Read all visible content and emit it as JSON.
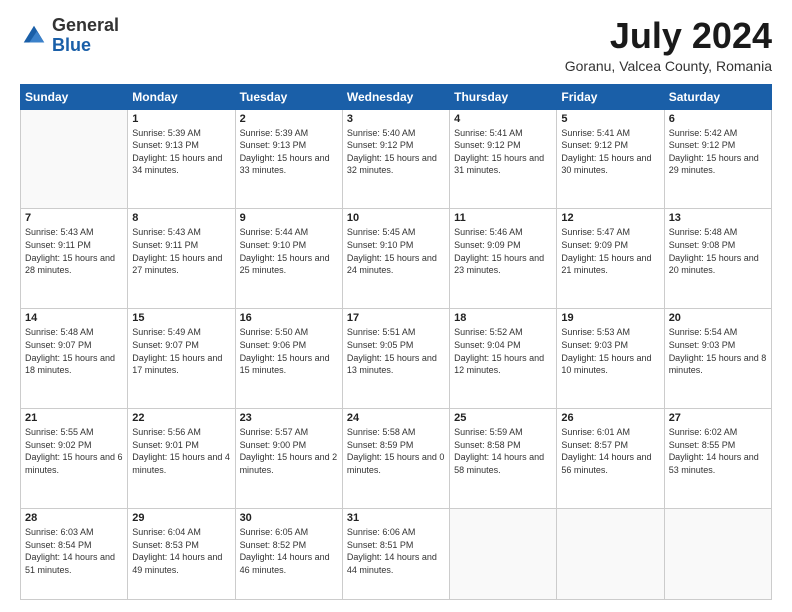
{
  "header": {
    "logo_general": "General",
    "logo_blue": "Blue",
    "month_title": "July 2024",
    "location": "Goranu, Valcea County, Romania"
  },
  "days": [
    "Sunday",
    "Monday",
    "Tuesday",
    "Wednesday",
    "Thursday",
    "Friday",
    "Saturday"
  ],
  "weeks": [
    [
      {
        "date": "",
        "sunrise": "",
        "sunset": "",
        "daylight": ""
      },
      {
        "date": "1",
        "sunrise": "Sunrise: 5:39 AM",
        "sunset": "Sunset: 9:13 PM",
        "daylight": "Daylight: 15 hours and 34 minutes."
      },
      {
        "date": "2",
        "sunrise": "Sunrise: 5:39 AM",
        "sunset": "Sunset: 9:13 PM",
        "daylight": "Daylight: 15 hours and 33 minutes."
      },
      {
        "date": "3",
        "sunrise": "Sunrise: 5:40 AM",
        "sunset": "Sunset: 9:12 PM",
        "daylight": "Daylight: 15 hours and 32 minutes."
      },
      {
        "date": "4",
        "sunrise": "Sunrise: 5:41 AM",
        "sunset": "Sunset: 9:12 PM",
        "daylight": "Daylight: 15 hours and 31 minutes."
      },
      {
        "date": "5",
        "sunrise": "Sunrise: 5:41 AM",
        "sunset": "Sunset: 9:12 PM",
        "daylight": "Daylight: 15 hours and 30 minutes."
      },
      {
        "date": "6",
        "sunrise": "Sunrise: 5:42 AM",
        "sunset": "Sunset: 9:12 PM",
        "daylight": "Daylight: 15 hours and 29 minutes."
      }
    ],
    [
      {
        "date": "7",
        "sunrise": "Sunrise: 5:43 AM",
        "sunset": "Sunset: 9:11 PM",
        "daylight": "Daylight: 15 hours and 28 minutes."
      },
      {
        "date": "8",
        "sunrise": "Sunrise: 5:43 AM",
        "sunset": "Sunset: 9:11 PM",
        "daylight": "Daylight: 15 hours and 27 minutes."
      },
      {
        "date": "9",
        "sunrise": "Sunrise: 5:44 AM",
        "sunset": "Sunset: 9:10 PM",
        "daylight": "Daylight: 15 hours and 25 minutes."
      },
      {
        "date": "10",
        "sunrise": "Sunrise: 5:45 AM",
        "sunset": "Sunset: 9:10 PM",
        "daylight": "Daylight: 15 hours and 24 minutes."
      },
      {
        "date": "11",
        "sunrise": "Sunrise: 5:46 AM",
        "sunset": "Sunset: 9:09 PM",
        "daylight": "Daylight: 15 hours and 23 minutes."
      },
      {
        "date": "12",
        "sunrise": "Sunrise: 5:47 AM",
        "sunset": "Sunset: 9:09 PM",
        "daylight": "Daylight: 15 hours and 21 minutes."
      },
      {
        "date": "13",
        "sunrise": "Sunrise: 5:48 AM",
        "sunset": "Sunset: 9:08 PM",
        "daylight": "Daylight: 15 hours and 20 minutes."
      }
    ],
    [
      {
        "date": "14",
        "sunrise": "Sunrise: 5:48 AM",
        "sunset": "Sunset: 9:07 PM",
        "daylight": "Daylight: 15 hours and 18 minutes."
      },
      {
        "date": "15",
        "sunrise": "Sunrise: 5:49 AM",
        "sunset": "Sunset: 9:07 PM",
        "daylight": "Daylight: 15 hours and 17 minutes."
      },
      {
        "date": "16",
        "sunrise": "Sunrise: 5:50 AM",
        "sunset": "Sunset: 9:06 PM",
        "daylight": "Daylight: 15 hours and 15 minutes."
      },
      {
        "date": "17",
        "sunrise": "Sunrise: 5:51 AM",
        "sunset": "Sunset: 9:05 PM",
        "daylight": "Daylight: 15 hours and 13 minutes."
      },
      {
        "date": "18",
        "sunrise": "Sunrise: 5:52 AM",
        "sunset": "Sunset: 9:04 PM",
        "daylight": "Daylight: 15 hours and 12 minutes."
      },
      {
        "date": "19",
        "sunrise": "Sunrise: 5:53 AM",
        "sunset": "Sunset: 9:03 PM",
        "daylight": "Daylight: 15 hours and 10 minutes."
      },
      {
        "date": "20",
        "sunrise": "Sunrise: 5:54 AM",
        "sunset": "Sunset: 9:03 PM",
        "daylight": "Daylight: 15 hours and 8 minutes."
      }
    ],
    [
      {
        "date": "21",
        "sunrise": "Sunrise: 5:55 AM",
        "sunset": "Sunset: 9:02 PM",
        "daylight": "Daylight: 15 hours and 6 minutes."
      },
      {
        "date": "22",
        "sunrise": "Sunrise: 5:56 AM",
        "sunset": "Sunset: 9:01 PM",
        "daylight": "Daylight: 15 hours and 4 minutes."
      },
      {
        "date": "23",
        "sunrise": "Sunrise: 5:57 AM",
        "sunset": "Sunset: 9:00 PM",
        "daylight": "Daylight: 15 hours and 2 minutes."
      },
      {
        "date": "24",
        "sunrise": "Sunrise: 5:58 AM",
        "sunset": "Sunset: 8:59 PM",
        "daylight": "Daylight: 15 hours and 0 minutes."
      },
      {
        "date": "25",
        "sunrise": "Sunrise: 5:59 AM",
        "sunset": "Sunset: 8:58 PM",
        "daylight": "Daylight: 14 hours and 58 minutes."
      },
      {
        "date": "26",
        "sunrise": "Sunrise: 6:01 AM",
        "sunset": "Sunset: 8:57 PM",
        "daylight": "Daylight: 14 hours and 56 minutes."
      },
      {
        "date": "27",
        "sunrise": "Sunrise: 6:02 AM",
        "sunset": "Sunset: 8:55 PM",
        "daylight": "Daylight: 14 hours and 53 minutes."
      }
    ],
    [
      {
        "date": "28",
        "sunrise": "Sunrise: 6:03 AM",
        "sunset": "Sunset: 8:54 PM",
        "daylight": "Daylight: 14 hours and 51 minutes."
      },
      {
        "date": "29",
        "sunrise": "Sunrise: 6:04 AM",
        "sunset": "Sunset: 8:53 PM",
        "daylight": "Daylight: 14 hours and 49 minutes."
      },
      {
        "date": "30",
        "sunrise": "Sunrise: 6:05 AM",
        "sunset": "Sunset: 8:52 PM",
        "daylight": "Daylight: 14 hours and 46 minutes."
      },
      {
        "date": "31",
        "sunrise": "Sunrise: 6:06 AM",
        "sunset": "Sunset: 8:51 PM",
        "daylight": "Daylight: 14 hours and 44 minutes."
      },
      {
        "date": "",
        "sunrise": "",
        "sunset": "",
        "daylight": ""
      },
      {
        "date": "",
        "sunrise": "",
        "sunset": "",
        "daylight": ""
      },
      {
        "date": "",
        "sunrise": "",
        "sunset": "",
        "daylight": ""
      }
    ]
  ]
}
